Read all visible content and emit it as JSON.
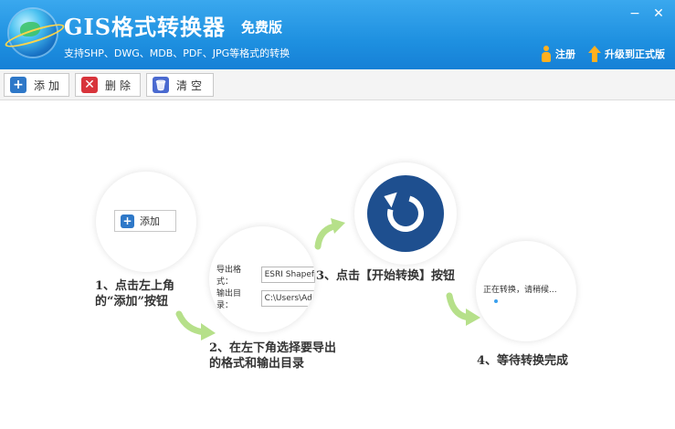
{
  "header": {
    "title": "GIS格式转换器",
    "edition": "免费版",
    "subtitle": "支持SHP、DWG、MDB、PDF、JPG等格式的转换",
    "register_label": "注册",
    "upgrade_label": "升级到正式版",
    "minimize_glyph": "−",
    "close_glyph": "✕"
  },
  "toolbar": {
    "add_label": "添加",
    "delete_label": "删除",
    "clear_label": "清空"
  },
  "steps": {
    "step1_demo_button": "添加",
    "step1_text": "1、点击左上角的“添加”按钮",
    "step2_format_label": "导出格式：",
    "step2_format_value": "ESRI Shapefile",
    "step2_dir_label": "输出目录：",
    "step2_dir_value": "C:\\Users\\Adm",
    "step2_text": "2、在左下角选择要导出的格式和输出目录",
    "step3_text": "3、点击【开始转换】按钮",
    "step4_status": "正在转换，请稍候...",
    "step4_text": "4、等待转换完成"
  },
  "icons": {
    "logo": "globe-logo-icon",
    "register": "person-icon",
    "upgrade": "up-arrow-icon",
    "add": "plus-icon",
    "delete": "x-icon",
    "clear": "trash-icon",
    "start": "refresh-icon"
  },
  "colors": {
    "header_blue": "#1e90e0",
    "accent_orange": "#ffb020",
    "arrow_green": "#b6e08a",
    "start_button": "#1e4f8f"
  }
}
